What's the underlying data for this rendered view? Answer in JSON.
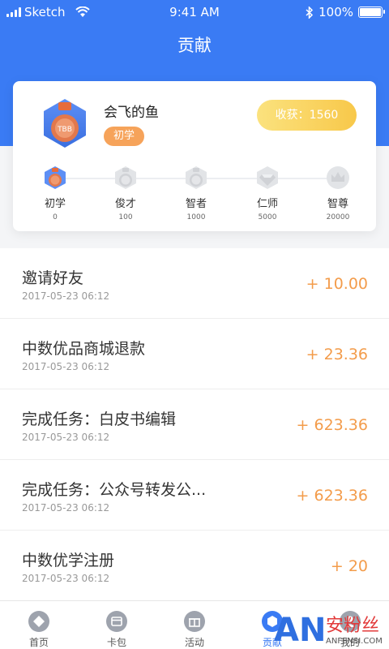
{
  "status_bar": {
    "carrier": "Sketch",
    "time": "9:41 AM",
    "battery": "100%"
  },
  "header": {
    "title": "贡献"
  },
  "profile": {
    "badge_text": "TBB",
    "name": "会飞的鱼",
    "level_tag": "初学",
    "harvest_label": "收获：1560"
  },
  "levels": [
    {
      "name": "初学",
      "value": "0",
      "badge": "TBB",
      "icon": "medal-icon",
      "active": true
    },
    {
      "name": "俊才",
      "value": "100",
      "badge": "TBB",
      "icon": "medal-icon",
      "active": false
    },
    {
      "name": "智者",
      "value": "1000",
      "badge": "TBB",
      "icon": "medal-icon",
      "active": false
    },
    {
      "name": "仁师",
      "value": "5000",
      "badge": "",
      "icon": "diamond-icon",
      "active": false
    },
    {
      "name": "智尊",
      "value": "20000",
      "badge": "",
      "icon": "crown-icon",
      "active": false
    }
  ],
  "records": [
    {
      "title": "邀请好友",
      "date": "2017-05-23 06:12",
      "amount": "+ 10.00"
    },
    {
      "title": "中数优品商城退款",
      "date": "2017-05-23 06:12",
      "amount": "+ 23.36"
    },
    {
      "title": "完成任务：白皮书编辑",
      "date": "2017-05-23 06:12",
      "amount": "+ 623.36"
    },
    {
      "title": "完成任务：公众号转发公...",
      "date": "2017-05-23 06:12",
      "amount": "+ 623.36"
    },
    {
      "title": "中数优学注册",
      "date": "2017-05-23 06:12",
      "amount": "+ 20"
    }
  ],
  "tabs": [
    {
      "label": "首页",
      "icon": "home-icon",
      "active": false
    },
    {
      "label": "卡包",
      "icon": "card-icon",
      "active": false
    },
    {
      "label": "活动",
      "icon": "gift-icon",
      "active": false
    },
    {
      "label": "贡献",
      "icon": "contribution-icon",
      "active": true
    },
    {
      "label": "我的",
      "icon": "profile-icon",
      "active": false
    }
  ],
  "watermark": {
    "logo": "AN",
    "text": "安粉丝",
    "url": "ANFENSI.COM"
  },
  "colors": {
    "primary": "#3a7bf4",
    "accent": "#f39c4b",
    "harvest": "#f8c84a"
  }
}
